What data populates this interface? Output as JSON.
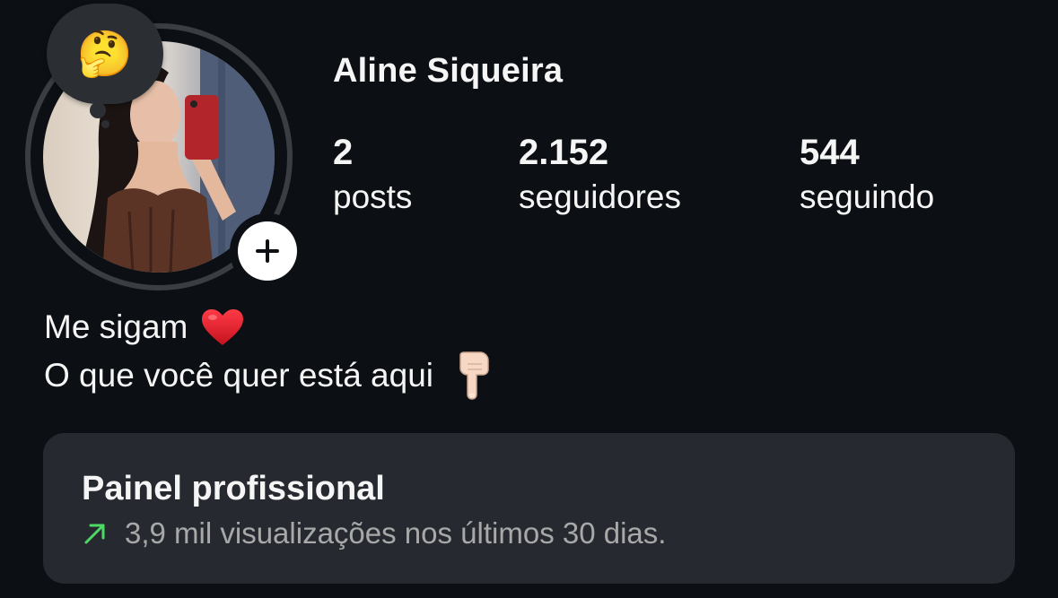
{
  "profile": {
    "username": "Aline Siqueira",
    "note_emoji": "🤔",
    "stats": {
      "posts_value": "2",
      "posts_label": "posts",
      "followers_value": "2.152",
      "followers_label": "seguidores",
      "following_value": "544",
      "following_label": "seguindo"
    }
  },
  "bio": {
    "line1": "Me sigam",
    "line2": "O que você quer está aqui"
  },
  "dashboard": {
    "title": "Painel profissional",
    "subtitle": "3,9 mil visualizações nos últimos 30 dias."
  },
  "icons": {
    "add_story": "plus-icon",
    "heart": "red-heart-icon",
    "pointing_down": "pointing-down-hand-icon",
    "trend": "trend-up-arrow-icon"
  },
  "colors": {
    "background": "#0c1014",
    "panel": "#262a30",
    "trend": "#4cd964",
    "heart": "#e0202e"
  }
}
